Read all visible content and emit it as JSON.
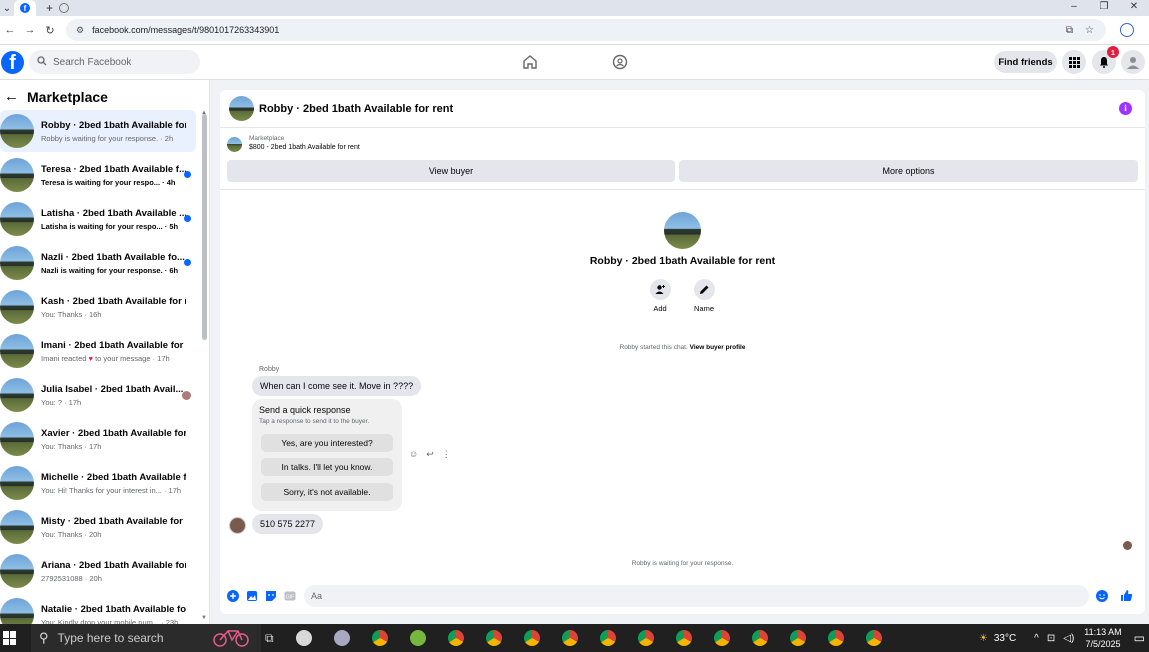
{
  "browser": {
    "url": "facebook.com/messages/t/9801017263343901",
    "tab_favicon": "f"
  },
  "fb_header": {
    "logo": "f",
    "search_placeholder": "Search Facebook",
    "find_friends": "Find friends",
    "notification_count": "1"
  },
  "sidebar": {
    "title": "Marketplace",
    "conversations": [
      {
        "title": "Robby · 2bed 1bath Available for...",
        "subtitle": "Robby is waiting for your response. · 2h",
        "unread": false,
        "active": true
      },
      {
        "title": "Teresa · 2bed 1bath Available f...",
        "subtitle": "Teresa is waiting for your respo... · 4h",
        "unread": true,
        "active": false
      },
      {
        "title": "Latisha · 2bed 1bath Available ...",
        "subtitle": "Latisha is waiting for your respo... · 5h",
        "unread": true,
        "active": false
      },
      {
        "title": "Nazli · 2bed 1bath Available fo...",
        "subtitle": "Nazli is waiting for your response. · 6h",
        "unread": true,
        "active": false
      },
      {
        "title": "Kash · 2bed 1bath Available for r...",
        "subtitle": "You: Thanks · 16h",
        "unread": false,
        "active": false
      },
      {
        "title": "Imani · 2bed 1bath Available for ...",
        "subtitle_pre": "Imani reacted ",
        "subtitle_post": " to your message · 17h",
        "unread": false,
        "active": false
      },
      {
        "title": "Julia Isabel · 2bed 1bath Avail...",
        "subtitle": "You: ? · 17h",
        "unread": false,
        "active": false
      },
      {
        "title": "Xavier · 2bed 1bath Available for...",
        "subtitle": "You: Thanks · 17h",
        "unread": false,
        "active": false
      },
      {
        "title": "Michelle · 2bed 1bath Available f...",
        "subtitle": "You: Hi! Thanks for your interest in... · 17h",
        "unread": false,
        "active": false
      },
      {
        "title": "Misty · 2bed 1bath Available for ...",
        "subtitle": "You: Thanks · 20h",
        "unread": false,
        "active": false
      },
      {
        "title": "Ariana · 2bed 1bath Available for...",
        "subtitle": "2792531088 · 20h",
        "unread": false,
        "active": false
      },
      {
        "title": "Natalie · 2bed 1bath Available fo...",
        "subtitle": "You: Kindly drop your mobile num... · 23h",
        "unread": false,
        "active": false
      }
    ]
  },
  "thread": {
    "header_name": "Robby · 2bed 1bath Available for rent",
    "listing_tag": "Marketplace",
    "listing_price_title": "$800 - 2bed 1bath Available for rent",
    "view_buyer": "View buyer",
    "more_options": "More options",
    "center_name": "Robby · 2bed 1bath Available for rent",
    "add_label": "Add",
    "name_label": "Name",
    "started_text": "Robby started this chat.",
    "view_profile": "View buyer profile",
    "sender_label": "Robby",
    "message_1": "When can I come see it.   Move in ????",
    "quick_title": "Send a quick response",
    "quick_sub": "Tap a response to send it to the buyer.",
    "quick_replies": [
      "Yes, are you interested?",
      "In talks. I'll let you know.",
      "Sorry, it's not available."
    ],
    "my_message": "510 575 2277",
    "waiting_text": "Robby is waiting for your response.",
    "composer_placeholder": "Aa"
  },
  "taskbar": {
    "search_placeholder": "Type here to search",
    "temperature": "33°C",
    "time": "11:13 AM",
    "date": "7/5/2025"
  }
}
